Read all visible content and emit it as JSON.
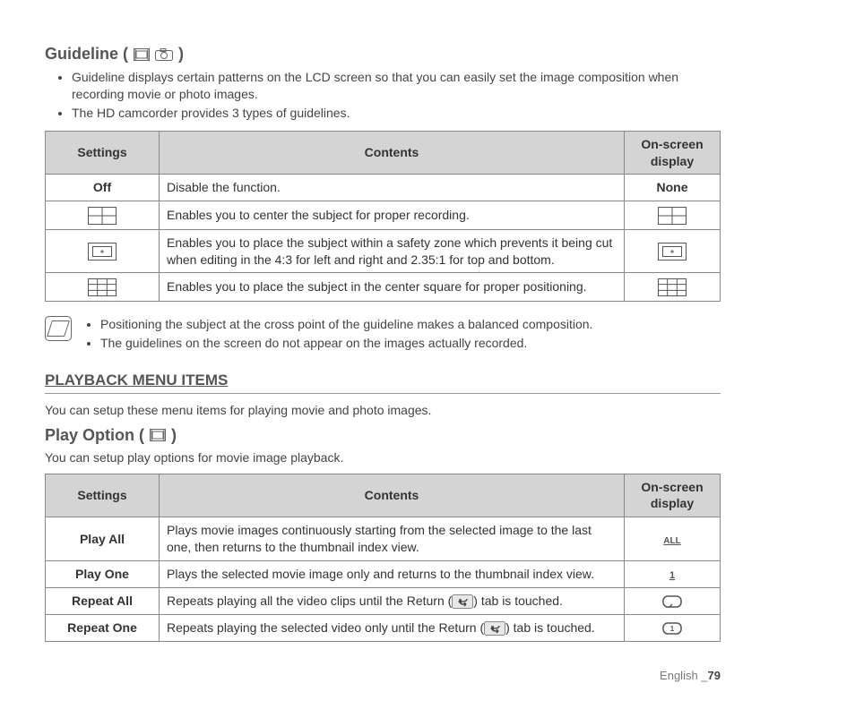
{
  "guideline": {
    "title": "Guideline (",
    "title_close": ")",
    "bullets": [
      "Guideline displays certain patterns on the LCD screen so that you can easily set the image composition when recording movie or photo images.",
      "The HD camcorder provides 3 types of guidelines."
    ],
    "table": {
      "headers": [
        "Settings",
        "Contents",
        "On-screen display"
      ],
      "rows": [
        {
          "setting": "Off",
          "icon": "",
          "content": "Disable the function.",
          "osd": "None",
          "osd_icon": ""
        },
        {
          "setting": "",
          "icon": "grid-cross",
          "content": "Enables you to center the subject for proper recording.",
          "osd": "",
          "osd_icon": "grid-cross"
        },
        {
          "setting": "",
          "icon": "grid-safety",
          "content": "Enables you to place the subject within a safety zone which prevents it being cut when editing in the 4:3 for left and right and 2.35:1 for top and bottom.",
          "osd": "",
          "osd_icon": "grid-safety"
        },
        {
          "setting": "",
          "icon": "grid-thirds",
          "content": "Enables you to place the subject in the center square for proper positioning.",
          "osd": "",
          "osd_icon": "grid-thirds"
        }
      ]
    },
    "note_items": [
      "Positioning the subject at the cross point of the guideline makes a balanced composition.",
      "The guidelines on the screen do not appear on the images actually recorded."
    ]
  },
  "playback": {
    "heading": "PLAYBACK MENU ITEMS",
    "intro": "You can setup these menu items for playing movie and photo images.",
    "play_option_title": "Play Option (",
    "play_option_title_close": ")",
    "play_option_desc": "You can setup play options for movie image playback.",
    "table": {
      "headers": [
        "Settings",
        "Contents",
        "On-screen display"
      ],
      "rows": [
        {
          "setting": "Play All",
          "content_pre": "Plays movie images continuously starting from the selected image to the last one, then returns to the thumbnail index view.",
          "has_return": false,
          "osd_icon": "play-all-icon"
        },
        {
          "setting": "Play One",
          "content_pre": "Plays the selected movie image only and returns to the thumbnail index view.",
          "has_return": false,
          "osd_icon": "play-one-icon"
        },
        {
          "setting": "Repeat All",
          "content_pre": "Repeats playing all the video clips until the Return (",
          "content_post": ") tab is touched.",
          "has_return": true,
          "osd_icon": "repeat-all-icon"
        },
        {
          "setting": "Repeat One",
          "content_pre": "Repeats playing the selected video only until the Return (",
          "content_post": ") tab is touched.",
          "has_return": true,
          "osd_icon": "repeat-one-icon"
        }
      ]
    }
  },
  "footer": {
    "label": "English _",
    "page": "79"
  }
}
